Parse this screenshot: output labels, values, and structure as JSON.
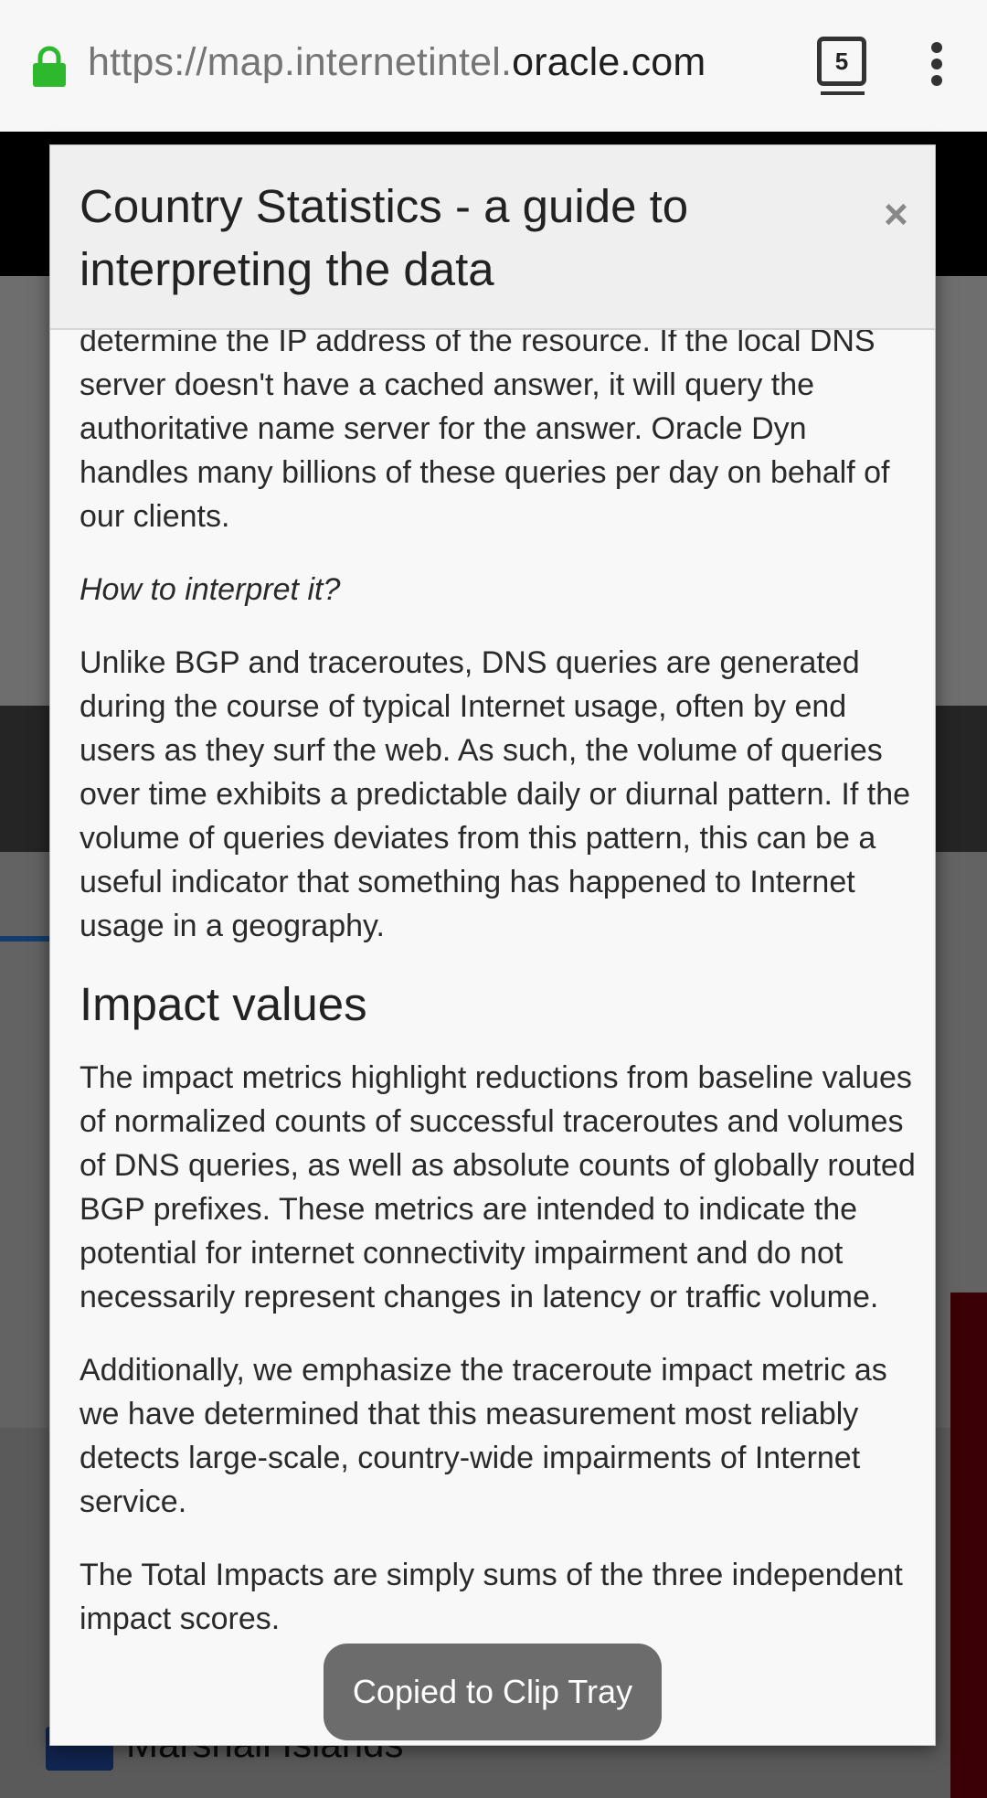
{
  "browser": {
    "url_prefix": "https://map.internetintel.",
    "url_host": "oracle.com",
    "tab_count": "5",
    "lock_color": "#2db82d"
  },
  "background": {
    "country_label": "Marshall Islands"
  },
  "modal": {
    "title": "Country Statistics - a guide to interpreting the data",
    "close_label": "×",
    "paragraphs": {
      "p1": "determine the IP address of the resource. If the local DNS server doesn't have a cached answer, it will query the authoritative name server for the answer. Oracle Dyn handles many billions of these queries per day on behalf of our clients.",
      "q1": "How to interpret it?",
      "p2": "Unlike BGP and traceroutes, DNS queries are generated during the course of typical Internet usage, often by end users as they surf the web. As such, the volume of queries over time exhibits a predictable daily or diurnal pattern. If the volume of queries deviates from this pattern, this can be a useful indicator that something has happened to Internet usage in a geography.",
      "h_impact": "Impact values",
      "p3": "The impact metrics highlight reductions from baseline values of normalized counts of successful traceroutes and volumes of DNS queries, as well as absolute counts of globally routed BGP prefixes. These metrics are intended to indicate the potential for internet connectivity impairment and do not necessarily represent changes in latency or traffic volume.",
      "p4": "Additionally, we emphasize the traceroute impact metric as we have determined that this measurement most reliably detects large-scale, country-wide impairments of Internet service.",
      "p5": "The Total Impacts are simply sums of the three independent impact scores."
    }
  },
  "toast": {
    "message": "Copied to Clip Tray"
  }
}
